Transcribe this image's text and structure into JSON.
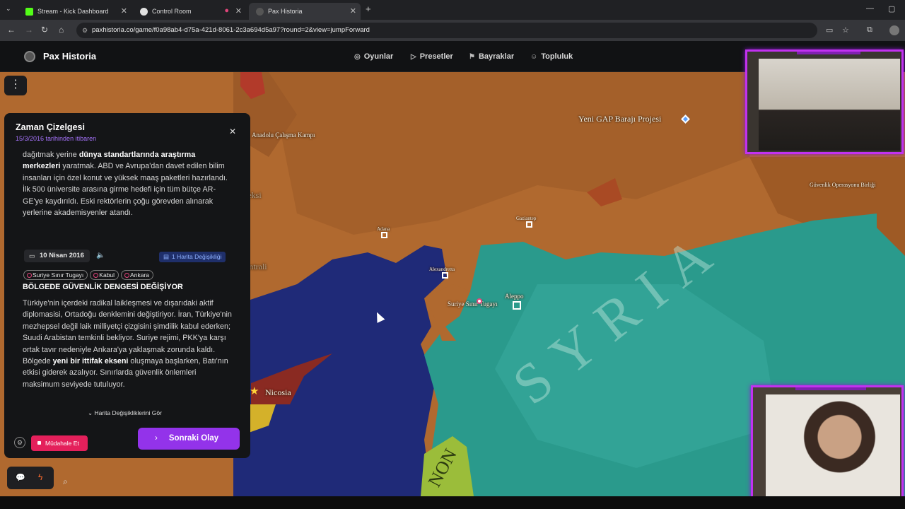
{
  "browser": {
    "tabs": [
      {
        "label": "Stream - Kick Dashboard",
        "favicon_color": "#53fc18"
      },
      {
        "label": "Control Room",
        "favicon_color": "#e0e0e0"
      },
      {
        "label": "Pax Historia",
        "favicon_color": "#333333"
      }
    ],
    "url": "paxhistoria.co/game/f0a98ab4-d75a-421d-8061-2c3a694d5a97?round=2&view=jumpForward"
  },
  "app": {
    "brand": "Pax Historia",
    "nav": [
      "Oyunlar",
      "Presetler",
      "Bayraklar",
      "Topluluk"
    ]
  },
  "map": {
    "labels": {
      "anadolu": "Anadolu Çalışma Kampı",
      "gap": "Yeni GAP Barajı Projesi",
      "guvenlik": "Güvenlik Operasyonu Birliği",
      "adana": "Adana",
      "gaziantep": "Gaziantep",
      "alexandretta": "Alexandretta",
      "aleppo": "Aleppo",
      "suriye_sinir": "Suriye Sınır Tugayı",
      "nicosia": "Nicosia",
      "leksi": "leksi",
      "akkuyu": "Akkuyu Nükleer Santrali",
      "syria": "SYRIA",
      "lebanon": "NON"
    }
  },
  "panel": {
    "title": "Zaman Çizelgesi",
    "subtitle": "15/3/2016 tarihinden itibaren",
    "para1_a": "dağıtmak yerine ",
    "para1_b": "dünya standartlarında araştırma merkezleri",
    "para1_c": " yaratmak. ABD ve Avrupa'dan davet edilen bilim insanları için özel konut ve yüksek maaş paketleri hazırlandı. İlk 500 üniversite arasına girme hedefi için tüm bütçe AR-GE'ye kaydırıldı. Eski rektörlerin çoğu görevden alınarak yerlerine akademisyenler atandı.",
    "date": "10 Nisan 2016",
    "map_changes": "1 Harita Değişikliği",
    "tags": [
      "Suriye Sınır Tugayı",
      "Kabul",
      "Ankara"
    ],
    "headline": "BÖLGEDE GÜVENLİK DENGESİ DEĞİŞİYOR",
    "para2_a": "Türkiye'nin içerdeki radikal laikleşmesi ve dışarıdaki aktif diplomasisi, Ortadoğu denklemini değiştiriyor. İran, Türkiye'nin mezhepsel değil laik milliyetçi çizgisini şimdilik kabul ederken; Suudi Arabistan temkinli bekliyor. Suriye rejimi, PKK'ya karşı ortak tavır nedeniyle Ankara'ya yaklaşmak zorunda kaldı. Bölgede ",
    "para2_b": "yeni bir ittifak ekseni",
    "para2_c": " oluşmaya başlarken, Batı'nın etkisi giderek azalıyor. Sınırlarda güvenlik önlemleri maksimum seviyede tutuluyor.",
    "see_changes": "Harita Değişikliklerini Gör",
    "intervene": "Müdahale Et",
    "next": "Sonraki Olay"
  },
  "colors": {
    "turkey": "#b0692f",
    "syria": "#2a9a8c",
    "sea": "#1f2a78",
    "lebanon": "#9bbd3a",
    "accent": "#9333ea",
    "danger": "#e4205b",
    "overlay_border": "#c231f0"
  }
}
